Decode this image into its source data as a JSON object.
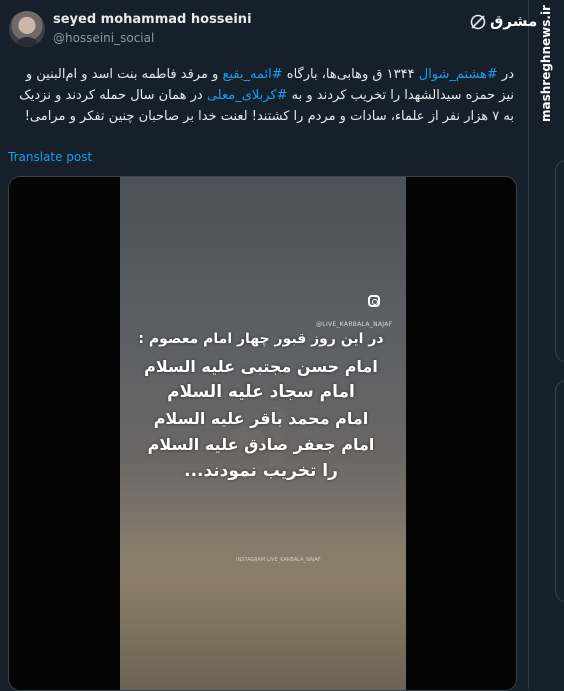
{
  "post": {
    "author_name": "seyed mohammad hosseini",
    "author_handle": "@hosseini_social",
    "text_parts": {
      "p1": "در ",
      "tag1": "#هشتم_شوال",
      "p2": " ۱۳۴۴ ق وهابی‌ها، بارگاه ",
      "tag2": "#ائمه_بقیع",
      "p3": " و مرقد فاطمه بنت اسد و ام‌البنین و نیز حمزه سیدالشهدا را تخریب کردند و به ",
      "tag3": "#کربلای_معلی",
      "p4": " در همان سال حمله کردند و نزدیک به ۷ هزار نفر از علماء، سادات و مردم را کشتند! لعنت خدا بر صاحبان چنین تفکر و مرامی!"
    },
    "translate_label": "Translate post"
  },
  "video": {
    "instagram_handle": "@LIVE_KARBALA_NAJAF",
    "overlay_lines": [
      "در این روز قبور چهار امام معصوم :",
      "امام حسن مجتبی علیه السلام",
      "امام سجاد علیه السلام",
      "امام محمد باقر علیه السلام",
      "امام جعفر صادق علیه السلام",
      "را تخریب نمودند..."
    ],
    "watermark": "INSTAGRAM LIVE_KARBALA_NAJAF"
  },
  "branding": {
    "logo_text": "مشرق",
    "site_url": "mashreghnews.ir"
  },
  "colors": {
    "background": "#15202b",
    "link": "#1d9bf0",
    "text": "#e7e9ea",
    "muted": "#8b98a5"
  }
}
